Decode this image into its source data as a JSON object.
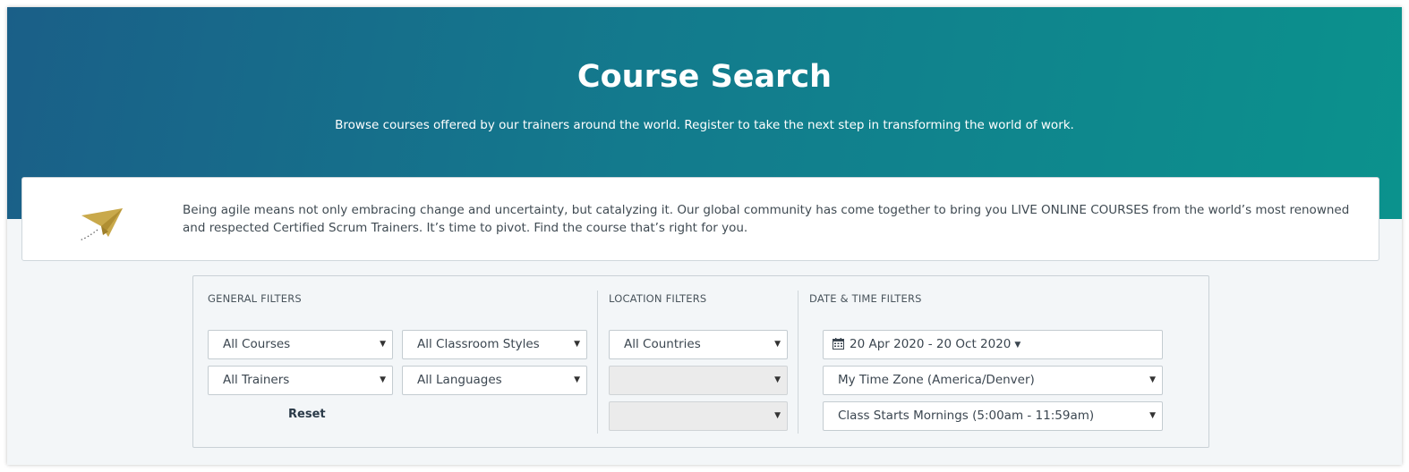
{
  "hero": {
    "title": "Course Search",
    "subtitle": "Browse courses offered by our trainers around the world. Register to take the next step in transforming the world of work."
  },
  "notice": {
    "icon": "paper-plane-icon",
    "text": "Being agile means not only embracing change and uncertainty, but catalyzing it. Our global community has come together to bring you LIVE ONLINE COURSES from the world’s most renowned and respected Certified Scrum Trainers. It’s time to pivot. Find the course that’s right for you."
  },
  "filters": {
    "general": {
      "label": "GENERAL FILTERS",
      "courses": "All Courses",
      "classroom_styles": "All Classroom Styles",
      "trainers": "All Trainers",
      "languages": "All Languages",
      "reset_label": "Reset"
    },
    "location": {
      "label": "LOCATION FILTERS",
      "countries": "All Countries",
      "region": "",
      "city": ""
    },
    "datetime": {
      "label": "DATE & TIME FILTERS",
      "date_range": "20 Apr 2020 - 20 Oct 2020",
      "time_zone": "My Time Zone (America/Denver)",
      "class_starts": "Class Starts Mornings (5:00am - 11:59am)"
    }
  },
  "colors": {
    "hero_start": "#1a5f88",
    "hero_end": "#0b928d",
    "plane": "#c9a94b"
  }
}
